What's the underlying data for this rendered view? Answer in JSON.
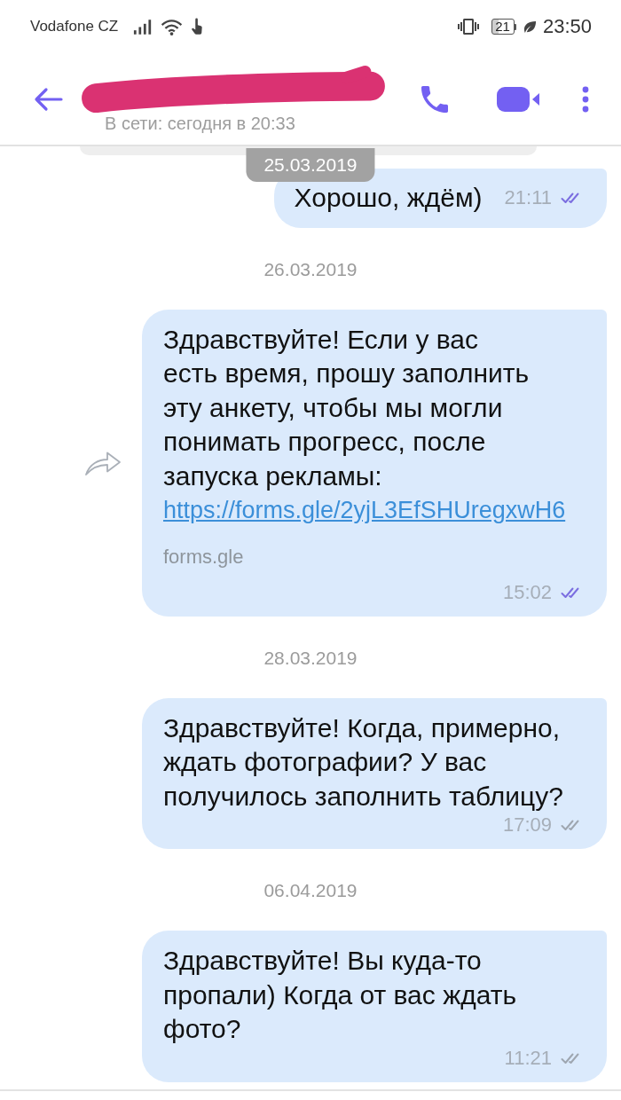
{
  "status_bar": {
    "carrier": "Vodafone CZ",
    "battery": "21",
    "time": "23:50"
  },
  "header": {
    "name_redacted": true,
    "status": "В сети: сегодня в 20:33"
  },
  "sticky_date": "25.03.2019",
  "items": [
    {
      "kind": "message",
      "lines": [
        "Хорошо, ждём)"
      ],
      "time": "21:11",
      "read": true,
      "forwardable": false
    },
    {
      "kind": "date",
      "text": "26.03.2019"
    },
    {
      "kind": "message",
      "lines": [
        "Здравствуйте! Если у вас",
        "есть время, прошу заполнить",
        "эту анкету, чтобы мы могли",
        "понимать прогресс, после",
        "запуска рекламы:"
      ],
      "link": "https://forms.gle/2yjL3EfSHUregxwH6",
      "link_domain": "forms.gle",
      "time": "15:02",
      "read": true,
      "forwardable": true
    },
    {
      "kind": "date",
      "text": "28.03.2019"
    },
    {
      "kind": "message",
      "lines": [
        "Здравствуйте! Когда, примерно,",
        "ждать фотографии? У вас",
        "получилось заполнить таблицу?"
      ],
      "time": "17:09",
      "read": false,
      "forwardable": false
    },
    {
      "kind": "date",
      "text": "06.04.2019"
    },
    {
      "kind": "message",
      "lines": [
        "Здравствуйте! Вы куда-то",
        "пропали) Когда от вас ждать",
        "фото?"
      ],
      "time": "11:21",
      "read": false,
      "forwardable": false
    }
  ]
}
